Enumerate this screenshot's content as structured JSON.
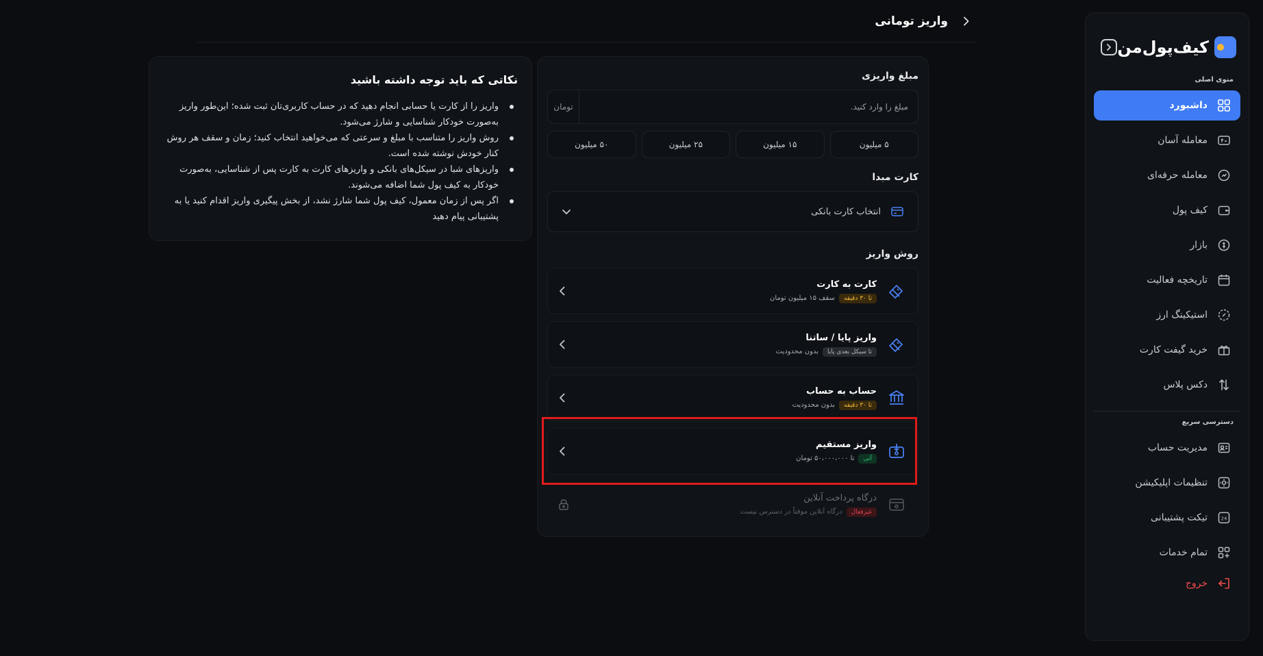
{
  "brand": {
    "name": "کیف‌پول‌من",
    "accent": "#3f7bf5"
  },
  "sidebar": {
    "main_menu_label": "منوی اصلی",
    "items": [
      {
        "label": "داشبورد",
        "icon": "dashboard-grid-icon",
        "active": true
      },
      {
        "label": "معامله آسان",
        "icon": "easy-trade-icon"
      },
      {
        "label": "معامله حرفه‌ای",
        "icon": "pro-trade-icon"
      },
      {
        "label": "کیف پول",
        "icon": "wallet-icon"
      },
      {
        "label": "بازار",
        "icon": "market-icon"
      },
      {
        "label": "تاریخچه فعالیت",
        "icon": "calendar-history-icon"
      },
      {
        "label": "استیکینگ ارز",
        "icon": "staking-icon"
      },
      {
        "label": "خرید گیفت کارت",
        "icon": "gift-card-icon"
      },
      {
        "label": "دکس پلاس",
        "icon": "dex-plus-icon"
      }
    ],
    "quick_access_label": "دسترسی سریع",
    "quick_items": [
      {
        "label": "مدیریت حساب",
        "icon": "account-icon"
      },
      {
        "label": "تنظیمات اپلیکیشن",
        "icon": "app-settings-icon"
      },
      {
        "label": "تیکت پشتیبانی",
        "icon": "support-ticket-icon"
      },
      {
        "label": "تمام خدمات",
        "icon": "all-services-icon"
      }
    ],
    "logout_label": "خروج"
  },
  "header": {
    "title": "واریز تومانی"
  },
  "deposit": {
    "amount_label": "مبلغ واریزی",
    "amount_placeholder": "مبلغ را وارد کنید.",
    "amount_unit": "تومان",
    "quick_amounts": [
      "۵ میلیون",
      "۱۵ میلیون",
      "۲۵ میلیون",
      "۵۰ میلیون"
    ],
    "source_card_label": "کارت مبدا",
    "source_card_placeholder": "انتخاب کارت بانکی",
    "method_label": "روش واریز",
    "methods": [
      {
        "title": "کارت به کارت",
        "badge": "تا ۳۰ دقیقه",
        "badge_type": "warn",
        "meta": "سقف ۱۵ میلیون تومان",
        "icon": "card-to-card-icon"
      },
      {
        "title": "واریز پایا / ساتنا",
        "badge": "تا سیکل بعدی پایا",
        "badge_type": "gray",
        "meta": "بدون محدودیت",
        "icon": "paya-satna-icon"
      },
      {
        "title": "حساب به حساب",
        "badge": "تا ۳۰ دقیقه",
        "badge_type": "warn",
        "meta": "بدون محدودیت",
        "icon": "bank-transfer-icon"
      },
      {
        "title": "واریز مستقیم",
        "badge": "آنی",
        "badge_type": "green",
        "meta": "تا ۵۰،۰۰۰،۰۰۰ تومان",
        "icon": "direct-deposit-icon"
      },
      {
        "title": "درگاه پرداخت آنلاین",
        "badge": "غیرفعال",
        "badge_type": "red",
        "meta": "درگاه آنلاین موقتاً در دسترس نیست",
        "icon": "online-gateway-icon",
        "disabled": true
      }
    ]
  },
  "notes": {
    "title": "نکاتی که باید توجه داشته باشید",
    "items": [
      "واریز را از کارت یا حسابی انجام دهید که در حساب کاربری‌تان ثبت شده؛ این‌طور واریز به‌صورت خودکار شناسایی و شارژ می‌شود.",
      "روش واریز را متناسب با مبلغ و سرعتی که می‌خواهید انتخاب کنید؛ زمان و سقف هر روش کنار خودش نوشته شده است.",
      "واریزهای شبا در سیکل‌های بانکی و واریزهای کارت به کارت پس از شناسایی، به‌صورت خودکار به کیف پول شما اضافه می‌شوند.",
      "اگر پس از زمان معمول، کیف پول شما شارژ نشد، از بخش پیگیری واریز اقدام کنید یا به پشتیبانی پیام دهید"
    ]
  }
}
